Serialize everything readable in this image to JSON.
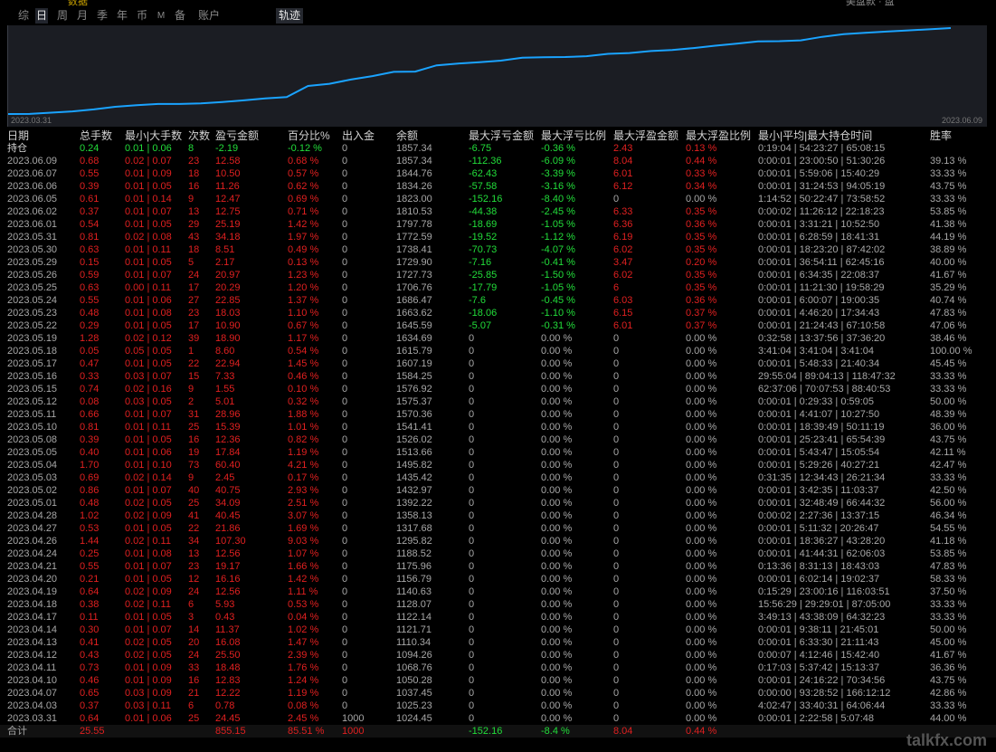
{
  "period_tabs": [
    "综",
    "日",
    "周",
    "月",
    "季",
    "年",
    "币",
    "M",
    "备",
    "账户"
  ],
  "active_tab": "日",
  "trajectory_button": "轨迹",
  "top_fragments": {
    "left": "数据",
    "right": "美盘款 · 盘"
  },
  "chart": {
    "start_date": "2023.03.31",
    "end_date": "2023.06.09",
    "line_color": "#1aa3ff",
    "background": "#1b1d23"
  },
  "chart_data": {
    "type": "line",
    "x_range": [
      "2023.03.31",
      "2023.06.09"
    ],
    "values": [
      1024.45,
      1025.23,
      1037.45,
      1050.28,
      1068.76,
      1094.26,
      1110.34,
      1121.71,
      1122.14,
      1128.07,
      1140.63,
      1156.79,
      1175.96,
      1188.52,
      1295.82,
      1317.68,
      1358.13,
      1392.22,
      1432.97,
      1435.42,
      1495.82,
      1513.66,
      1526.02,
      1541.41,
      1570.36,
      1575.37,
      1576.92,
      1584.25,
      1607.19,
      1615.79,
      1634.69,
      1645.59,
      1663.62,
      1686.47,
      1706.76,
      1727.73,
      1729.9,
      1738.41,
      1772.59,
      1797.78,
      1810.53,
      1823.0,
      1834.26,
      1844.76,
      1857.34
    ]
  },
  "columns": [
    "日期",
    "总手数",
    "最小|大手数",
    "次数",
    "盈亏金额",
    "百分比%",
    "出入金",
    "余额",
    "最大浮亏金额",
    "最大浮亏比例",
    "最大浮盈金额",
    "最大浮盈比例",
    "最小|平均|最大持仓时间",
    "胜率"
  ],
  "position_row": [
    "持仓",
    "0.24",
    "0.01 | 0.06",
    "8",
    "-2.19",
    "-0.12 %",
    "0",
    "1857.34",
    "-6.75",
    "-0.36 %",
    "2.43",
    "0.13 %",
    "0:19:04 | 54:23:27 | 65:08:15",
    ""
  ],
  "rows": [
    [
      "2023.06.09",
      "0.68",
      "0.02 | 0.07",
      "23",
      "12.58",
      "0.68 %",
      "0",
      "1857.34",
      "-112.36",
      "-6.09 %",
      "8.04",
      "0.44 %",
      "0:00:01 | 23:00:50 | 51:30:26",
      "39.13 %"
    ],
    [
      "2023.06.07",
      "0.55",
      "0.01 | 0.09",
      "18",
      "10.50",
      "0.57 %",
      "0",
      "1844.76",
      "-62.43",
      "-3.39 %",
      "6.01",
      "0.33 %",
      "0:00:01 | 5:59:06 | 15:40:29",
      "33.33 %"
    ],
    [
      "2023.06.06",
      "0.39",
      "0.01 | 0.05",
      "16",
      "11.26",
      "0.62 %",
      "0",
      "1834.26",
      "-57.58",
      "-3.16 %",
      "6.12",
      "0.34 %",
      "0:00:01 | 31:24:53 | 94:05:19",
      "43.75 %"
    ],
    [
      "2023.06.05",
      "0.61",
      "0.01 | 0.14",
      "9",
      "12.47",
      "0.69 %",
      "0",
      "1823.00",
      "-152.16",
      "-8.40 %",
      "0",
      "0.00 %",
      "1:14:52 | 50:22:47 | 73:58:52",
      "33.33 %"
    ],
    [
      "2023.06.02",
      "0.37",
      "0.01 | 0.07",
      "13",
      "12.75",
      "0.71 %",
      "0",
      "1810.53",
      "-44.38",
      "-2.45 %",
      "6.33",
      "0.35 %",
      "0:00:02 | 11:26:12 | 22:18:23",
      "53.85 %"
    ],
    [
      "2023.06.01",
      "0.54",
      "0.01 | 0.05",
      "29",
      "25.19",
      "1.42 %",
      "0",
      "1797.78",
      "-18.69",
      "-1.05 %",
      "6.36",
      "0.36 %",
      "0:00:01 | 3:31:21 | 10:52:50",
      "41.38 %"
    ],
    [
      "2023.05.31",
      "0.81",
      "0.02 | 0.08",
      "43",
      "34.18",
      "1.97 %",
      "0",
      "1772.59",
      "-19.52",
      "-1.12 %",
      "6.19",
      "0.35 %",
      "0:00:01 | 6:28:59 | 18:41:31",
      "44.19 %"
    ],
    [
      "2023.05.30",
      "0.63",
      "0.01 | 0.11",
      "18",
      "8.51",
      "0.49 %",
      "0",
      "1738.41",
      "-70.73",
      "-4.07 %",
      "6.02",
      "0.35 %",
      "0:00:01 | 18:23:20 | 87:42:02",
      "38.89 %"
    ],
    [
      "2023.05.29",
      "0.15",
      "0.01 | 0.05",
      "5",
      "2.17",
      "0.13 %",
      "0",
      "1729.90",
      "-7.16",
      "-0.41 %",
      "3.47",
      "0.20 %",
      "0:00:01 | 36:54:11 | 62:45:16",
      "40.00 %"
    ],
    [
      "2023.05.26",
      "0.59",
      "0.01 | 0.07",
      "24",
      "20.97",
      "1.23 %",
      "0",
      "1727.73",
      "-25.85",
      "-1.50 %",
      "6.02",
      "0.35 %",
      "0:00:01 | 6:34:35 | 22:08:37",
      "41.67 %"
    ],
    [
      "2023.05.25",
      "0.63",
      "0.00 | 0.11",
      "17",
      "20.29",
      "1.20 %",
      "0",
      "1706.76",
      "-17.79",
      "-1.05 %",
      "6",
      "0.35 %",
      "0:00:01 | 11:21:30 | 19:58:29",
      "35.29 %"
    ],
    [
      "2023.05.24",
      "0.55",
      "0.01 | 0.06",
      "27",
      "22.85",
      "1.37 %",
      "0",
      "1686.47",
      "-7.6",
      "-0.45 %",
      "6.03",
      "0.36 %",
      "0:00:01 | 6:00:07 | 19:00:35",
      "40.74 %"
    ],
    [
      "2023.05.23",
      "0.48",
      "0.01 | 0.08",
      "23",
      "18.03",
      "1.10 %",
      "0",
      "1663.62",
      "-18.06",
      "-1.10 %",
      "6.15",
      "0.37 %",
      "0:00:01 | 4:46:20 | 17:34:43",
      "47.83 %"
    ],
    [
      "2023.05.22",
      "0.29",
      "0.01 | 0.05",
      "17",
      "10.90",
      "0.67 %",
      "0",
      "1645.59",
      "-5.07",
      "-0.31 %",
      "6.01",
      "0.37 %",
      "0:00:01 | 21:24:43 | 67:10:58",
      "47.06 %"
    ],
    [
      "2023.05.19",
      "1.28",
      "0.02 | 0.12",
      "39",
      "18.90",
      "1.17 %",
      "0",
      "1634.69",
      "0",
      "0.00 %",
      "0",
      "0.00 %",
      "0:32:58 | 13:37:56 | 37:36:20",
      "38.46 %"
    ],
    [
      "2023.05.18",
      "0.05",
      "0.05 | 0.05",
      "1",
      "8.60",
      "0.54 %",
      "0",
      "1615.79",
      "0",
      "0.00 %",
      "0",
      "0.00 %",
      "3:41:04 | 3:41:04 | 3:41:04",
      "100.00 %"
    ],
    [
      "2023.05.17",
      "0.47",
      "0.01 | 0.05",
      "22",
      "22.94",
      "1.45 %",
      "0",
      "1607.19",
      "0",
      "0.00 %",
      "0",
      "0.00 %",
      "0:00:01 | 5:48:33 | 21:40:34",
      "45.45 %"
    ],
    [
      "2023.05.16",
      "0.33",
      "0.03 | 0.07",
      "15",
      "7.33",
      "0.46 %",
      "0",
      "1584.25",
      "0",
      "0.00 %",
      "0",
      "0.00 %",
      "29:55:04 | 89:04:13 | 118:47:32",
      "33.33 %"
    ],
    [
      "2023.05.15",
      "0.74",
      "0.02 | 0.16",
      "9",
      "1.55",
      "0.10 %",
      "0",
      "1576.92",
      "0",
      "0.00 %",
      "0",
      "0.00 %",
      "62:37:06 | 70:07:53 | 88:40:53",
      "33.33 %"
    ],
    [
      "2023.05.12",
      "0.08",
      "0.03 | 0.05",
      "2",
      "5.01",
      "0.32 %",
      "0",
      "1575.37",
      "0",
      "0.00 %",
      "0",
      "0.00 %",
      "0:00:01 | 0:29:33 | 0:59:05",
      "50.00 %"
    ],
    [
      "2023.05.11",
      "0.66",
      "0.01 | 0.07",
      "31",
      "28.96",
      "1.88 %",
      "0",
      "1570.36",
      "0",
      "0.00 %",
      "0",
      "0.00 %",
      "0:00:01 | 4:41:07 | 10:27:50",
      "48.39 %"
    ],
    [
      "2023.05.10",
      "0.81",
      "0.01 | 0.11",
      "25",
      "15.39",
      "1.01 %",
      "0",
      "1541.41",
      "0",
      "0.00 %",
      "0",
      "0.00 %",
      "0:00:01 | 18:39:49 | 50:11:19",
      "36.00 %"
    ],
    [
      "2023.05.08",
      "0.39",
      "0.01 | 0.05",
      "16",
      "12.36",
      "0.82 %",
      "0",
      "1526.02",
      "0",
      "0.00 %",
      "0",
      "0.00 %",
      "0:00:01 | 25:23:41 | 65:54:39",
      "43.75 %"
    ],
    [
      "2023.05.05",
      "0.40",
      "0.01 | 0.06",
      "19",
      "17.84",
      "1.19 %",
      "0",
      "1513.66",
      "0",
      "0.00 %",
      "0",
      "0.00 %",
      "0:00:01 | 5:43:47 | 15:05:54",
      "42.11 %"
    ],
    [
      "2023.05.04",
      "1.70",
      "0.01 | 0.10",
      "73",
      "60.40",
      "4.21 %",
      "0",
      "1495.82",
      "0",
      "0.00 %",
      "0",
      "0.00 %",
      "0:00:01 | 5:29:26 | 40:27:21",
      "42.47 %"
    ],
    [
      "2023.05.03",
      "0.69",
      "0.02 | 0.14",
      "9",
      "2.45",
      "0.17 %",
      "0",
      "1435.42",
      "0",
      "0.00 %",
      "0",
      "0.00 %",
      "0:31:35 | 12:34:43 | 26:21:34",
      "33.33 %"
    ],
    [
      "2023.05.02",
      "0.86",
      "0.01 | 0.07",
      "40",
      "40.75",
      "2.93 %",
      "0",
      "1432.97",
      "0",
      "0.00 %",
      "0",
      "0.00 %",
      "0:00:01 | 3:42:35 | 11:03:37",
      "42.50 %"
    ],
    [
      "2023.05.01",
      "0.48",
      "0.02 | 0.05",
      "25",
      "34.09",
      "2.51 %",
      "0",
      "1392.22",
      "0",
      "0.00 %",
      "0",
      "0.00 %",
      "0:00:01 | 32:48:49 | 66:44:32",
      "56.00 %"
    ],
    [
      "2023.04.28",
      "1.02",
      "0.02 | 0.09",
      "41",
      "40.45",
      "3.07 %",
      "0",
      "1358.13",
      "0",
      "0.00 %",
      "0",
      "0.00 %",
      "0:00:02 | 2:27:36 | 13:37:15",
      "46.34 %"
    ],
    [
      "2023.04.27",
      "0.53",
      "0.01 | 0.05",
      "22",
      "21.86",
      "1.69 %",
      "0",
      "1317.68",
      "0",
      "0.00 %",
      "0",
      "0.00 %",
      "0:00:01 | 5:11:32 | 20:26:47",
      "54.55 %"
    ],
    [
      "2023.04.26",
      "1.44",
      "0.02 | 0.11",
      "34",
      "107.30",
      "9.03 %",
      "0",
      "1295.82",
      "0",
      "0.00 %",
      "0",
      "0.00 %",
      "0:00:01 | 18:36:27 | 43:28:20",
      "41.18 %"
    ],
    [
      "2023.04.24",
      "0.25",
      "0.01 | 0.08",
      "13",
      "12.56",
      "1.07 %",
      "0",
      "1188.52",
      "0",
      "0.00 %",
      "0",
      "0.00 %",
      "0:00:01 | 41:44:31 | 62:06:03",
      "53.85 %"
    ],
    [
      "2023.04.21",
      "0.55",
      "0.01 | 0.07",
      "23",
      "19.17",
      "1.66 %",
      "0",
      "1175.96",
      "0",
      "0.00 %",
      "0",
      "0.00 %",
      "0:13:36 | 8:31:13 | 18:43:03",
      "47.83 %"
    ],
    [
      "2023.04.20",
      "0.21",
      "0.01 | 0.05",
      "12",
      "16.16",
      "1.42 %",
      "0",
      "1156.79",
      "0",
      "0.00 %",
      "0",
      "0.00 %",
      "0:00:01 | 6:02:14 | 19:02:37",
      "58.33 %"
    ],
    [
      "2023.04.19",
      "0.64",
      "0.02 | 0.09",
      "24",
      "12.56",
      "1.11 %",
      "0",
      "1140.63",
      "0",
      "0.00 %",
      "0",
      "0.00 %",
      "0:15:29 | 23:00:16 | 116:03:51",
      "37.50 %"
    ],
    [
      "2023.04.18",
      "0.38",
      "0.02 | 0.11",
      "6",
      "5.93",
      "0.53 %",
      "0",
      "1128.07",
      "0",
      "0.00 %",
      "0",
      "0.00 %",
      "15:56:29 | 29:29:01 | 87:05:00",
      "33.33 %"
    ],
    [
      "2023.04.17",
      "0.11",
      "0.01 | 0.05",
      "3",
      "0.43",
      "0.04 %",
      "0",
      "1122.14",
      "0",
      "0.00 %",
      "0",
      "0.00 %",
      "3:49:13 | 43:38:09 | 64:32:23",
      "33.33 %"
    ],
    [
      "2023.04.14",
      "0.30",
      "0.01 | 0.07",
      "14",
      "11.37",
      "1.02 %",
      "0",
      "1121.71",
      "0",
      "0.00 %",
      "0",
      "0.00 %",
      "0:00:01 | 9:38:11 | 21:45:01",
      "50.00 %"
    ],
    [
      "2023.04.13",
      "0.41",
      "0.02 | 0.05",
      "20",
      "16.08",
      "1.47 %",
      "0",
      "1110.34",
      "0",
      "0.00 %",
      "0",
      "0.00 %",
      "0:00:01 | 6:33:30 | 21:11:43",
      "45.00 %"
    ],
    [
      "2023.04.12",
      "0.43",
      "0.02 | 0.05",
      "24",
      "25.50",
      "2.39 %",
      "0",
      "1094.26",
      "0",
      "0.00 %",
      "0",
      "0.00 %",
      "0:00:07 | 4:12:46 | 15:42:40",
      "41.67 %"
    ],
    [
      "2023.04.11",
      "0.73",
      "0.01 | 0.09",
      "33",
      "18.48",
      "1.76 %",
      "0",
      "1068.76",
      "0",
      "0.00 %",
      "0",
      "0.00 %",
      "0:17:03 | 5:37:42 | 15:13:37",
      "36.36 %"
    ],
    [
      "2023.04.10",
      "0.46",
      "0.01 | 0.09",
      "16",
      "12.83",
      "1.24 %",
      "0",
      "1050.28",
      "0",
      "0.00 %",
      "0",
      "0.00 %",
      "0:00:01 | 24:16:22 | 70:34:56",
      "43.75 %"
    ],
    [
      "2023.04.07",
      "0.65",
      "0.03 | 0.09",
      "21",
      "12.22",
      "1.19 %",
      "0",
      "1037.45",
      "0",
      "0.00 %",
      "0",
      "0.00 %",
      "0:00:00 | 93:28:52 | 166:12:12",
      "42.86 %"
    ],
    [
      "2023.04.03",
      "0.37",
      "0.03 | 0.11",
      "6",
      "0.78",
      "0.08 %",
      "0",
      "1025.23",
      "0",
      "0.00 %",
      "0",
      "0.00 %",
      "4:02:47 | 33:40:31 | 64:06:44",
      "33.33 %"
    ],
    [
      "2023.03.31",
      "0.64",
      "0.01 | 0.06",
      "25",
      "24.45",
      "2.45 %",
      "1000",
      "1024.45",
      "0",
      "0.00 %",
      "0",
      "0.00 %",
      "0:00:01 | 2:22:58 | 5:07:48",
      "44.00 %"
    ]
  ],
  "total_row": [
    "合计",
    "25.55",
    "",
    "",
    "855.15",
    "85.51 %",
    "1000",
    "",
    "-152.16",
    "-8.4 %",
    "8.04",
    "0.44 %",
    "",
    ""
  ],
  "watermark": "talkfx.com"
}
